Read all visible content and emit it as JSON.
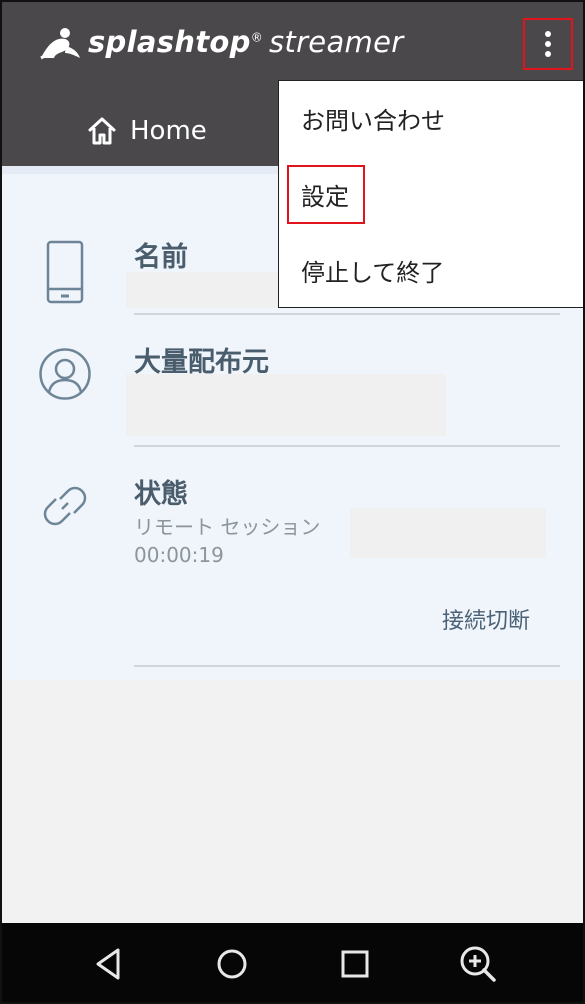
{
  "app": {
    "brand": "splashtop",
    "brand_mark": "®",
    "product": "streamer"
  },
  "tabs": [
    {
      "label": "Home",
      "icon": "home-icon"
    }
  ],
  "menu": {
    "items": [
      {
        "label": "お問い合わせ"
      },
      {
        "label": "設定",
        "highlighted": true
      },
      {
        "label": "停止して終了"
      }
    ]
  },
  "main": {
    "name": {
      "title": "名前",
      "icon": "phone-icon"
    },
    "distributor": {
      "title": "大量配布元",
      "icon": "user-icon"
    },
    "status": {
      "title": "状態",
      "icon": "link-icon",
      "session_label": "リモート セッション",
      "elapsed": "00:00:19",
      "disconnect_label": "接続切断"
    }
  },
  "navbar": {
    "icons": [
      "back-icon",
      "home-circle-icon",
      "recents-icon",
      "zoom-icon"
    ]
  },
  "colors": {
    "appbar": "#4a484b",
    "content_bg": "#f0f4fb",
    "highlight": "#e0141a",
    "title_text": "#4a5d6c",
    "muted_text": "#8c959c",
    "link_text": "#4b6276",
    "navbar": "#060606"
  }
}
